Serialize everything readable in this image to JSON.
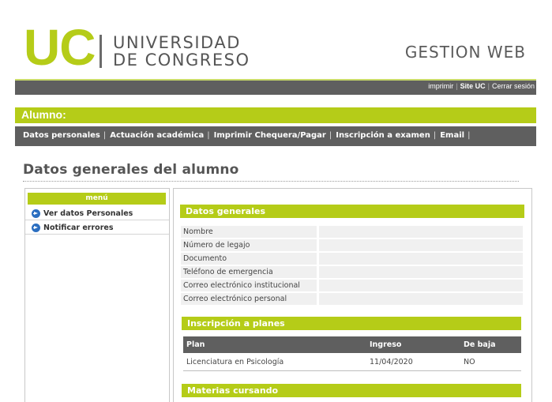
{
  "header": {
    "logo_letters": "UC",
    "logo_line1": "UNIVERSIDAD",
    "logo_line2": "DE CONGRESO",
    "app_name": "GESTION WEB",
    "accent_color": "#b5cc18",
    "bar_color": "#5f5f5f"
  },
  "topbar": {
    "links": [
      "imprimir",
      "Site UC",
      "Cerrar sesión"
    ],
    "separator": "|"
  },
  "alumno_title": "Alumno:",
  "nav": {
    "items": [
      "Datos personales",
      "Actuación académica",
      "Imprimir Chequera/Pagar",
      "Inscripción a examen",
      "Email"
    ],
    "separator": "|"
  },
  "page_title": "Datos generales del alumno",
  "menu": {
    "header": "menú",
    "items": [
      {
        "label": "Ver datos Personales",
        "icon": "arrow-right-circle-icon"
      },
      {
        "label": "Notificar errores",
        "icon": "arrow-right-circle-icon"
      }
    ]
  },
  "datos_generales": {
    "title": "Datos generales",
    "fields": [
      {
        "label": "Nombre",
        "value": ""
      },
      {
        "label": "Número de legajo",
        "value": ""
      },
      {
        "label": "Documento",
        "value": ""
      },
      {
        "label": "Teléfono de emergencia",
        "value": ""
      },
      {
        "label": "Correo electrónico institucional",
        "value": ""
      },
      {
        "label": "Correo electrónico personal",
        "value": ""
      }
    ]
  },
  "inscripcion_planes": {
    "title": "Inscripción a planes",
    "columns": [
      "Plan",
      "Ingreso",
      "De baja"
    ],
    "rows": [
      [
        "Licenciatura en Psicología",
        "11/04/2020",
        "NO"
      ]
    ]
  },
  "materias_cursando": {
    "title": "Materias cursando"
  }
}
